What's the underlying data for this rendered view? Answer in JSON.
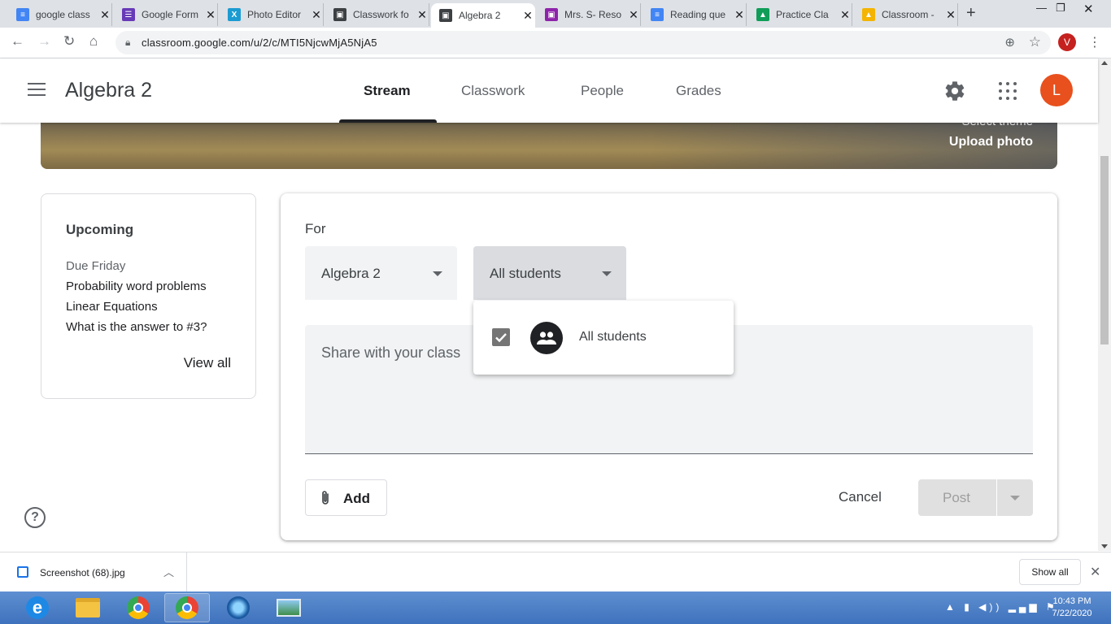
{
  "browser": {
    "tabs": [
      {
        "title": "google class",
        "color": "#4285f4",
        "glyph": "≡"
      },
      {
        "title": "Google Form",
        "color": "#673ab7",
        "glyph": "☰"
      },
      {
        "title": "Photo Editor",
        "color": "#1b9bd1",
        "glyph": "X"
      },
      {
        "title": "Classwork fo",
        "color": "#3c4043",
        "glyph": "▣"
      },
      {
        "title": "Algebra 2",
        "color": "#3c4043",
        "glyph": "▣",
        "active": true
      },
      {
        "title": "Mrs. S- Reso",
        "color": "#8e24aa",
        "glyph": "▣"
      },
      {
        "title": "Reading que",
        "color": "#4285f4",
        "glyph": "≡"
      },
      {
        "title": "Practice Cla",
        "color": "#0f9d58",
        "glyph": "▲"
      },
      {
        "title": "Classroom -",
        "color": "#f4b400",
        "glyph": "▲"
      }
    ],
    "url": "classroom.google.com/u/2/c/MTI5NjcwMjA5NjA5",
    "profile_initial": "V"
  },
  "app": {
    "class_name": "Algebra 2",
    "nav": {
      "stream": "Stream",
      "classwork": "Classwork",
      "people": "People",
      "grades": "Grades"
    },
    "user_initial": "L",
    "avatar_color": "#e8501d"
  },
  "banner": {
    "select_theme": "Select theme",
    "upload_photo": "Upload photo"
  },
  "upcoming": {
    "heading": "Upcoming",
    "due": "Due Friday",
    "items": [
      "Probability word problems",
      "Linear Equations",
      "What is the answer to #3?"
    ],
    "view_all": "View all"
  },
  "composer": {
    "for_label": "For",
    "class_select": "Algebra 2",
    "students_select": "All students",
    "placeholder": "Share with your class",
    "add_label": "Add",
    "cancel_label": "Cancel",
    "post_label": "Post",
    "dropdown_option": "All students"
  },
  "downloads": {
    "file_name": "Screenshot (68).jpg",
    "show_all": "Show all"
  },
  "taskbar": {
    "time": "10:43 PM",
    "date": "7/22/2020"
  }
}
